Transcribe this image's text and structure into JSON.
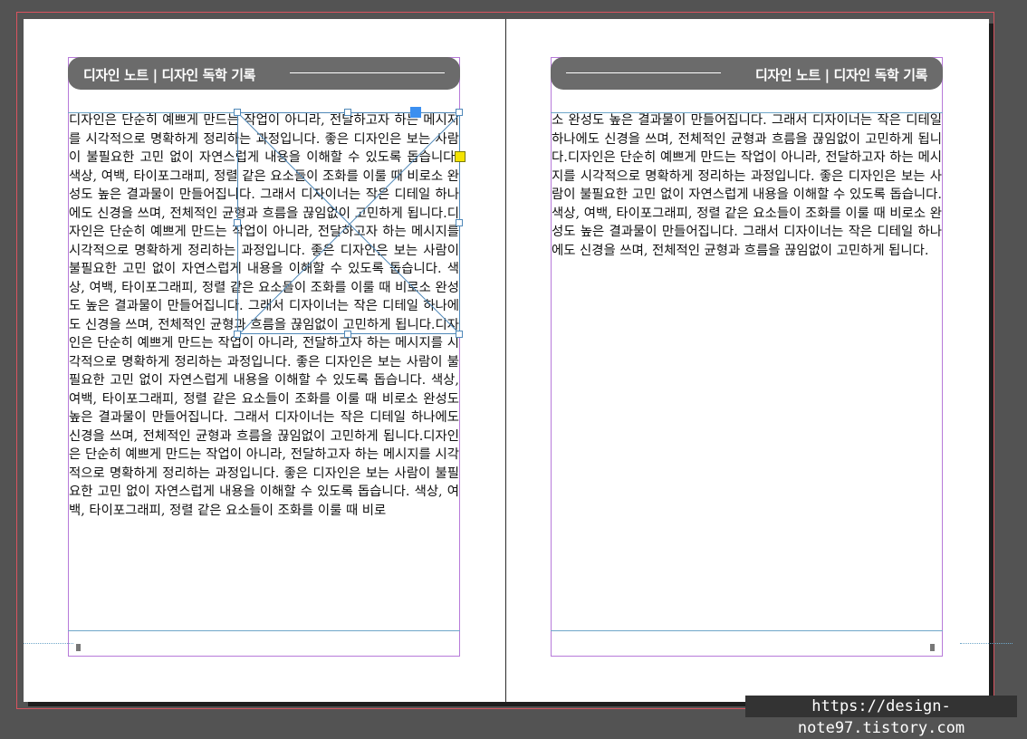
{
  "header": {
    "left_title": "디자인 노트 | 디자인 독학 기록",
    "right_title": "디자인 노트 | 디자인 독학 기록"
  },
  "left_page": {
    "body_text": "디자인은 단순히 예쁘게 만드는 작업이 아니라, 전달하고자 하는 메시지를 시각적으로 명확하게 정리하는 과정입니다. 좋은 디자인은 보는 사람이 불필요한 고민 없이 자연스럽게 내용을 이해할 수 있도록 돕습니다. 색상, 여백, 타이포그래피, 정렬 같은 요소들이 조화를 이룰 때 비로소 완성도 높은 결과물이 만들어집니다. 그래서 디자이너는 작은 디테일 하나에도 신경을 쓰며, 전체적인 균형과 흐름을 끊임없이 고민하게 됩니다.디자인은 단순히 예쁘게 만드는 작업이 아니라, 전달하고자 하는 메시지를 시각적으로 명확하게 정리하는 과정입니다. 좋은 디자인은 보는 사람이 불필요한 고민 없이 자연스럽게 내용을 이해할 수 있도록 돕습니다. 색상, 여백, 타이포그래피, 정렬 같은 요소들이 조화를 이룰 때 비로소 완성도 높은 결과물이 만들어집니다. 그래서 디자이너는 작은 디테일 하나에도 신경을 쓰며, 전체적인 균형과 흐름을 끊임없이 고민하게 됩니다.디자인은 단순히 예쁘게 만드는 작업이 아니라, 전달하고자 하는 메시지를 시각적으로 명확하게 정리하는 과정입니다. 좋은 디자인은 보는 사람이 불필요한 고민 없이 자연스럽게 내용을 이해할 수 있도록 돕습니다. 색상, 여백, 타이포그래피, 정렬 같은 요소들이 조화를 이룰 때 비로소 완성도 높은 결과물이 만들어집니다. 그래서 디자이너는 작은 디테일 하나에도 신경을 쓰며, 전체적인 균형과 흐름을 끊임없이 고민하게 됩니다.디자인은 단순히 예쁘게 만드는 작업이 아니라, 전달하고자 하는 메시지를 시각적으로 명확하게 정리하는 과정입니다. 좋은 디자인은 보는 사람이 불필요한 고민 없이 자연스럽게 내용을 이해할 수 있도록 돕습니다. 색상, 여백, 타이포그래피, 정렬 같은 요소들이 조화를 이룰 때 비로"
  },
  "right_page": {
    "body_text": "소 완성도 높은 결과물이 만들어집니다. 그래서 디자이너는 작은 디테일 하나에도 신경을 쓰며, 전체적인 균형과 흐름을 끊임없이 고민하게 됩니다.디자인은 단순히 예쁘게 만드는 작업이 아니라, 전달하고자 하는 메시지를 시각적으로 명확하게 정리하는 과정입니다. 좋은 디자인은 보는 사람이 불필요한 고민 없이 자연스럽게 내용을 이해할 수 있도록 돕습니다. 색상, 여백, 타이포그래피, 정렬 같은 요소들이 조화를 이룰 때 비로소 완성도 높은 결과물이 만들어집니다. 그래서 디자이너는 작은 디테일 하나에도 신경을 쓰며, 전체적인 균형과 흐름을 끊임없이 고민하게 됩니다."
  },
  "watermark": "https://design-note97.tistory.com",
  "colors": {
    "pasteboard": "#535353",
    "header_bar": "#6b6b6b",
    "margin_guide": "#b77ad9",
    "frame_edge": "#4f88b8",
    "bleed_guide": "#d9535f",
    "selection_handle": "#3b8ff0",
    "out_port": "#f4e300"
  }
}
